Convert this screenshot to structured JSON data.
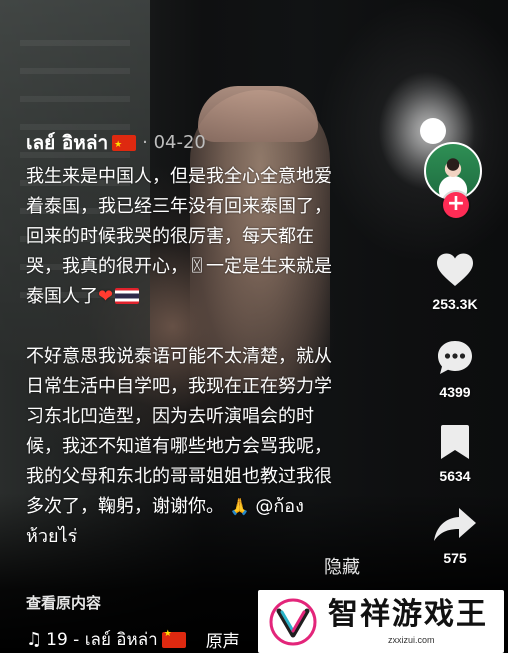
{
  "author": {
    "name": "เลย์  อิหล่า",
    "date": "· 04-20"
  },
  "caption": {
    "paragraph1": "我生来是中国人，但是我全心全意地爱\n着泰国，我已经三年没有回来泰国了，\n回来的时候我哭的很厉害，每天都在\n哭，我真的很开心，〿一定是生来就是\n泰国人了",
    "paragraph2_main": "不好意思我说泰语可能不太清楚，就从\n日常生活中自学吧，我现在正在努力学\n习东北凹造型，因为去听演唱会的时\n候，我还不知道有哪些地方会骂我呢，\n我的父母和东北的哥哥姐姐也教过我很\n多次了，鞠躬，谢谢你。",
    "mention": "@ก้อง\nห้วยไร่"
  },
  "actions": {
    "likes": "253.3K",
    "comments": "4399",
    "favorites": "5634",
    "shares": "575"
  },
  "hide_label": "隐藏",
  "view_original": "查看原内容",
  "music": {
    "track": "19 - เลย์  อิหล่า",
    "original_label": "原声"
  },
  "watermark": {
    "title": "智祥游戏王",
    "url": "zxxizui.com"
  },
  "icons": {
    "follow": "plus-icon",
    "like": "heart-icon",
    "comment": "comment-icon",
    "favorite": "bookmark-icon",
    "share": "share-icon",
    "music": "music-note-icon"
  },
  "colors": {
    "follow_button": "#fe2c55",
    "heart_emoji": "#ff3b30",
    "china_flag": "#de2910"
  }
}
